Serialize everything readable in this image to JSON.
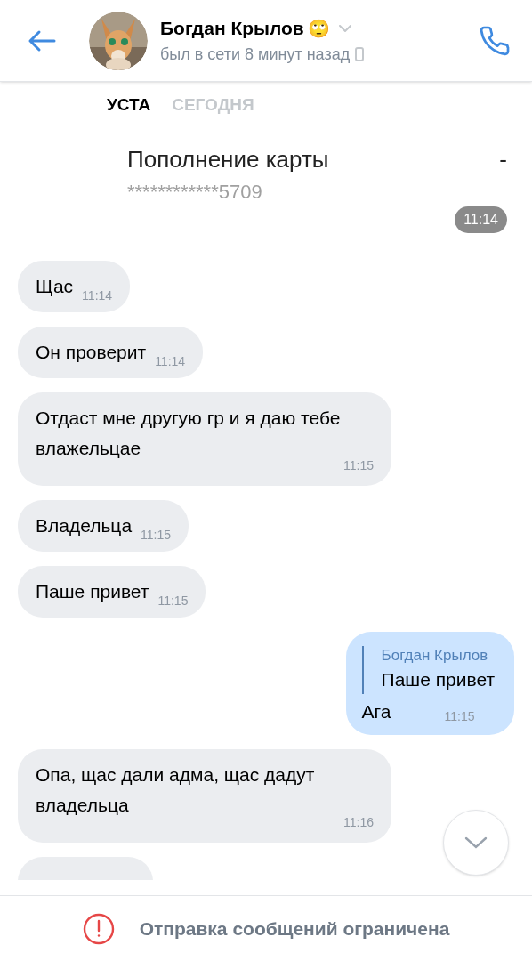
{
  "header": {
    "name": "Богдан Крылов",
    "emoji": "🙄",
    "status": "был в сети 8 минут назад"
  },
  "tabs": [
    {
      "label": "УСТА",
      "selected": true
    },
    {
      "label": "СЕГОДНЯ",
      "selected": false
    }
  ],
  "card": {
    "title": "Пополнение карты",
    "amount": "-",
    "number": "************5709",
    "time": "11:14"
  },
  "messages": [
    {
      "kind": "in",
      "text": "Щас",
      "time": "11:14"
    },
    {
      "kind": "in",
      "text": "Он проверит",
      "time": "11:14"
    },
    {
      "kind": "in",
      "text": "Отдаст мне другую гр и я даю тебе влажельцае",
      "time": "11:15"
    },
    {
      "kind": "in",
      "text": "Владельца",
      "time": "11:15"
    },
    {
      "kind": "in",
      "text": "Паше привет",
      "time": "11:15"
    },
    {
      "kind": "out",
      "reply_author": "Богдан Крылов",
      "reply_text": "Паше привет",
      "text": "Ага",
      "time": "11:15"
    },
    {
      "kind": "in",
      "text": "Опа, щас дали адма, щас дадут владельца",
      "time": "11:16"
    },
    {
      "kind": "partial"
    }
  ],
  "footer": {
    "text": "Отправка сообщений ограничена"
  }
}
